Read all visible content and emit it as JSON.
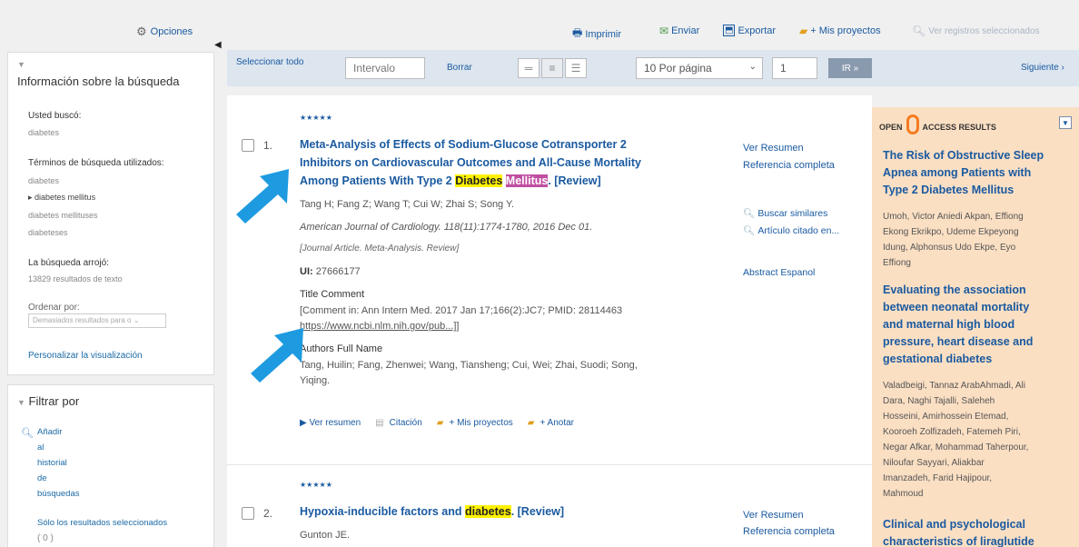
{
  "sidebar": {
    "options_label": "Opciones",
    "search_info_title": "Información sobre la búsqueda",
    "searched_label": "Usted buscó:",
    "searched_value": "diabetes",
    "terms_label": "Términos de búsqueda utilizados:",
    "terms": [
      "diabetes",
      "diabetes mellitus",
      "diabetes mellituses",
      "diabeteses"
    ],
    "result_label": "La búsqueda arrojó:",
    "result_value": "13829 resultados de texto",
    "sort_label": "Ordenar por:",
    "sort_selected": "Demasiados resultados para o",
    "customize_link": "Personalizar la visualización",
    "filter_title": "Filtrar por",
    "add_history_lines": [
      "Añadir",
      "al",
      "historial",
      "de",
      "búsquedas"
    ],
    "selected_only": "Sólo los resultados seleccionados",
    "selected_count": "( 0 )"
  },
  "topbar": {
    "print": "Imprimir",
    "send": "Enviar",
    "export": "Exportar",
    "my_projects": "+ Mis proyectos",
    "view_selected": "Ver registros seleccionados"
  },
  "toolbar": {
    "select_all": "Seleccionar todo",
    "range_placeholder": "Intervalo",
    "clear": "Borrar",
    "per_page": "10 Por página",
    "page_number": "1",
    "go": "IR »",
    "next": "Siguiente ›"
  },
  "results": [
    {
      "stars": "★★★★★",
      "number": "1.",
      "title_line1": "Meta-Analysis of Effects of Sodium-Glucose Cotransporter 2",
      "title_line2": "Inhibitors on Cardiovascular Outcomes and All-Cause Mortality",
      "title_line3_pre": "Among Patients With Type 2 ",
      "title_hl1": "Diabetes",
      "title_hl2": "Mellitus",
      "title_post": ". [Review]",
      "authors": "Tang H; Fang Z; Wang T; Cui W; Zhai S; Song Y.",
      "journal": "American Journal of Cardiology. 118(11):1774-1780, 2016 Dec 01.",
      "pubtype": "[Journal Article. Meta-Analysis. Review]",
      "ui_label": "UI:",
      "ui_value": "27666177",
      "comment_label": "Title Comment",
      "comment_text": "[Comment in: Ann Intern Med. 2017 Jan 17;166(2):JC7; PMID: 28114463",
      "comment_url": "https://www.ncbi.nlm.nih.gov/pub...]]",
      "full_name_label": "Authors Full Name",
      "full_name_line1": "Tang, Huilin; Fang, Zhenwei; Wang, Tiansheng; Cui, Wei; Zhai, Suodi; Song,",
      "full_name_line2": "Yiqing.",
      "view_summary": "Ver Resumen",
      "full_reference": "Referencia completa",
      "find_similar": "Buscar similares",
      "cited_in": "Artículo citado en...",
      "abstract_es": "Abstract Espanol",
      "act_view": "▶ Ver resumen",
      "act_cite": "Citación",
      "act_projects": "+ Mis proyectos",
      "act_annotate": "+ Anotar"
    },
    {
      "stars": "★★★★★",
      "number": "2.",
      "title_pre": "Hypoxia-inducible factors and ",
      "title_hl": "diabetes",
      "title_post": ". [Review]",
      "authors": "Gunton JE.",
      "view_summary": "Ver Resumen",
      "full_reference": "Referencia completa"
    }
  ],
  "open_access": {
    "head_open": "OPEN",
    "head_rest": "ACCESS RESULTS",
    "toggle": "▼",
    "items": [
      {
        "title_lines": [
          "The Risk of Obstructive Sleep",
          "Apnea among Patients with",
          "Type 2 Diabetes Mellitus"
        ],
        "author_lines": [
          "Umoh, Victor Aniedi Akpan, Effiong",
          "Ekong Ekrikpo, Udeme Ekpeyong",
          "Idung, Alphonsus Udo Ekpe, Eyo",
          "Effiong"
        ]
      },
      {
        "title_lines": [
          "Evaluating the association",
          "between neonatal mortality",
          "and maternal high blood",
          "pressure, heart disease and",
          "gestational diabetes"
        ],
        "author_lines": [
          "Valadbeigi, Tannaz ArabAhmadi, Ali",
          "Dara, Naghi Tajalli, Saleheh",
          "Hosseini, Amirhossein Etemad,",
          "Kooroeh Zolfizadeh, Fatemeh Piri,",
          "Negar Afkar, Mohammad Taherpour,",
          "Niloufar Sayyari, Aliakbar",
          "Imanzadeh, Farid Hajipour,",
          "Mahmoud"
        ]
      },
      {
        "title_lines": [
          "Clinical and psychological",
          "characteristics of liraglutide"
        ]
      }
    ]
  },
  "colors": {
    "link_blue": "#1a5aa0",
    "highlight_yellow": "#fff200",
    "highlight_magenta": "#c04fa0",
    "open_access_bg": "#fbdfc3",
    "arrow_blue": "#1e9be0"
  }
}
